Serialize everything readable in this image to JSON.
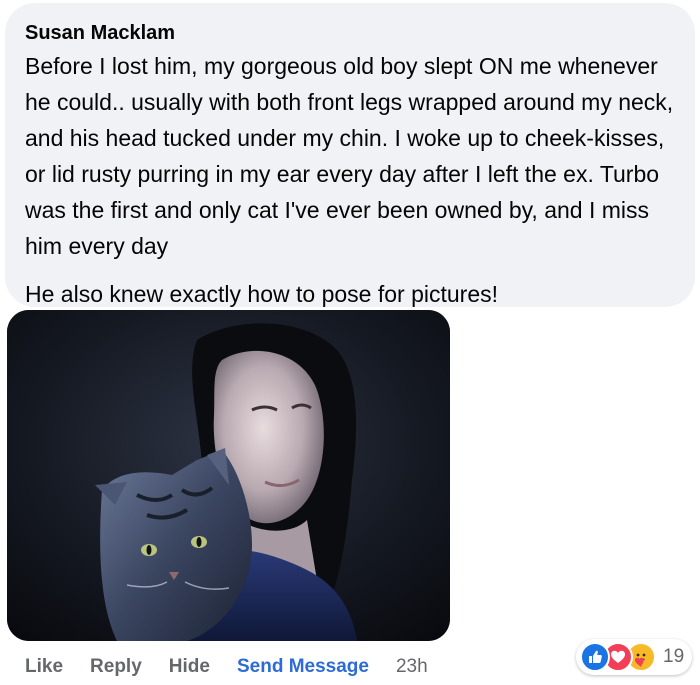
{
  "comment": {
    "author": "Susan Macklam",
    "paragraphs": [
      "Before I lost him, my gorgeous old boy slept ON me whenever he could.. usually with both front legs wrapped around my neck, and his head tucked under my chin. I woke up to cheek-kisses, or lid rusty purring in my ear every day after I left the ex. Turbo was the first and only cat I've ever been owned by, and I miss him every day",
      "He also knew exactly how to pose for pictures!"
    ]
  },
  "actions": {
    "like": "Like",
    "reply": "Reply",
    "hide": "Hide",
    "send_message": "Send Message",
    "time": "23h"
  },
  "reactions": {
    "icons": [
      "like-icon",
      "love-icon",
      "care-icon"
    ],
    "count": "19"
  },
  "colors": {
    "bubble_bg": "#f0f2f5",
    "action_text": "#65676b",
    "send_message": "#2d6bd6",
    "like": "#1b74e4",
    "love": "#f33e58",
    "care": "#f7b928"
  }
}
